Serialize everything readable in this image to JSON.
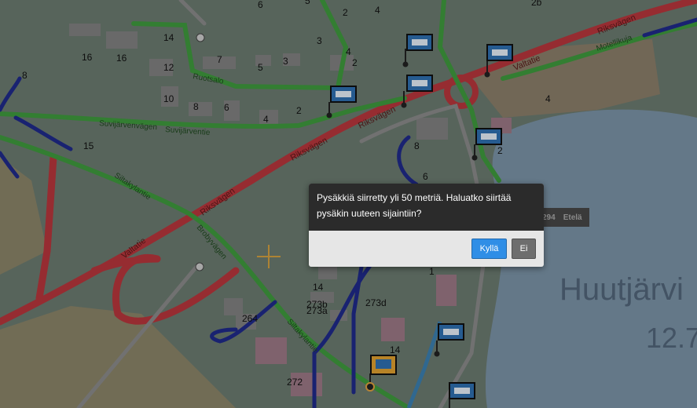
{
  "dialog": {
    "message": "Pysäkkiä siirretty yli 50 metriä. Haluatko siirtää pysäkin uuteen sijaintiin?",
    "confirm_label": "Kyllä",
    "cancel_label": "Ei"
  },
  "hint": {
    "number": "294",
    "direction": "Etelä"
  },
  "map": {
    "lake_name": "Huutjärvi",
    "lake_number": "12.7",
    "colors": {
      "land": "#6e7c72",
      "water": "#7f96a8",
      "road_red": "#b8363c",
      "road_green": "#3f9a3e",
      "route_blue": "#1f2a8a"
    },
    "road_labels": [
      "Riksvägen",
      "Valtatie",
      "Suvijärvenvägen",
      "Suvijärventie",
      "Siltakylantie",
      "Brobyvägen",
      "Motellikuja",
      "Ruotsalo"
    ],
    "house_numbers": [
      "14",
      "16",
      "16",
      "12",
      "7",
      "5",
      "3",
      "4",
      "2",
      "3",
      "8",
      "10",
      "8",
      "6",
      "4",
      "2",
      "15",
      "8",
      "6",
      "2",
      "4",
      "14",
      "273b",
      "273a",
      "273d",
      "264",
      "272",
      "14",
      "1",
      "5",
      "6",
      "4",
      "2",
      "2b"
    ]
  }
}
